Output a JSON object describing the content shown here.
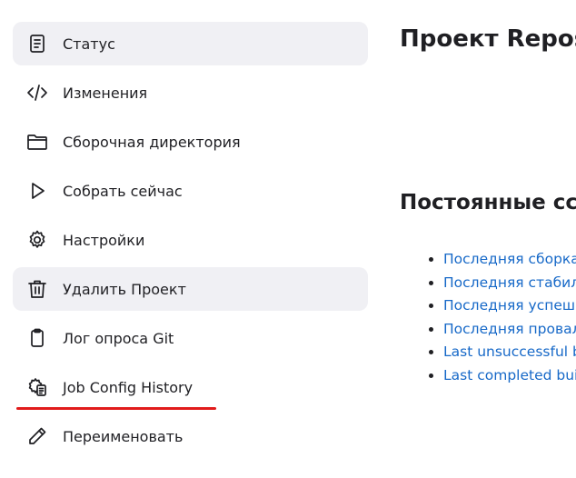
{
  "sidebar": {
    "items": [
      {
        "label": "Статус",
        "icon": "document-icon",
        "active": true
      },
      {
        "label": "Изменения",
        "icon": "code-icon",
        "active": false
      },
      {
        "label": "Сборочная директория",
        "icon": "folder-icon",
        "active": false
      },
      {
        "label": "Собрать сейчас",
        "icon": "play-icon",
        "active": false
      },
      {
        "label": "Настройки",
        "icon": "gear-icon",
        "active": false
      },
      {
        "label": "Удалить Проект",
        "icon": "trash-icon",
        "active": true
      },
      {
        "label": "Лог опроса Git",
        "icon": "clipboard-icon",
        "active": false
      },
      {
        "label": "Job Config History",
        "icon": "gear-document-icon",
        "active": false
      },
      {
        "label": "Переименовать",
        "icon": "pencil-icon",
        "active": false
      }
    ]
  },
  "main": {
    "title": "Проект Repos",
    "permalinks_title": "Постоянные сс",
    "permalinks": [
      "Последняя сборка",
      "Последняя стабил",
      "Последняя успешн",
      "Последняя провал",
      "Last unsuccessful b",
      "Last completed bui"
    ]
  },
  "colors": {
    "link": "#1769c8",
    "highlight_underline": "#e11b1b",
    "active_background": "#f0f0f4"
  }
}
